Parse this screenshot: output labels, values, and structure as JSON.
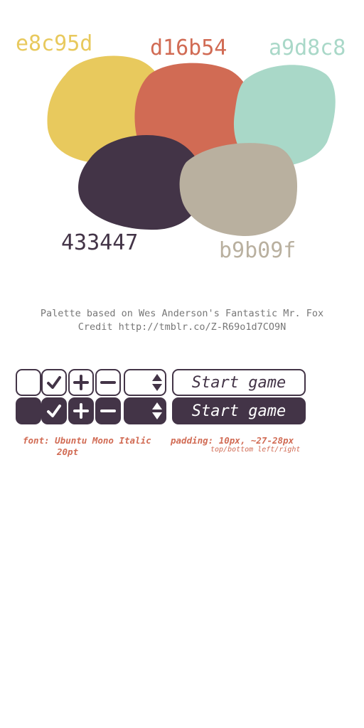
{
  "palette": {
    "yellow": {
      "hex_label": "e8c95d",
      "color": "#e8c95d"
    },
    "red": {
      "hex_label": "d16b54",
      "color": "#d16b54"
    },
    "teal": {
      "hex_label": "a9d8c8",
      "color": "#a9d8c8"
    },
    "plum": {
      "hex_label": "433447",
      "color": "#433447"
    },
    "taupe": {
      "hex_label": "b9b09f",
      "color": "#b9b09f"
    }
  },
  "credit": {
    "line1": "Palette based on Wes Anderson's Fantastic Mr. Fox",
    "line2": "Credit http://tmblr.co/Z-R69o1d7CO9N"
  },
  "buttons": {
    "light": {
      "start_label": "Start game"
    },
    "dark": {
      "start_label": "Start game"
    },
    "icons": [
      "blank",
      "check-icon",
      "plus-icon",
      "minus-icon",
      "spinner-arrows-icon"
    ]
  },
  "notes": {
    "font_line1": "font: Ubuntu Mono Italic",
    "font_line2": "20pt",
    "padding_line1": "padding: 10px, ~27-28px",
    "padding_line2": "top/bottom left/right"
  }
}
